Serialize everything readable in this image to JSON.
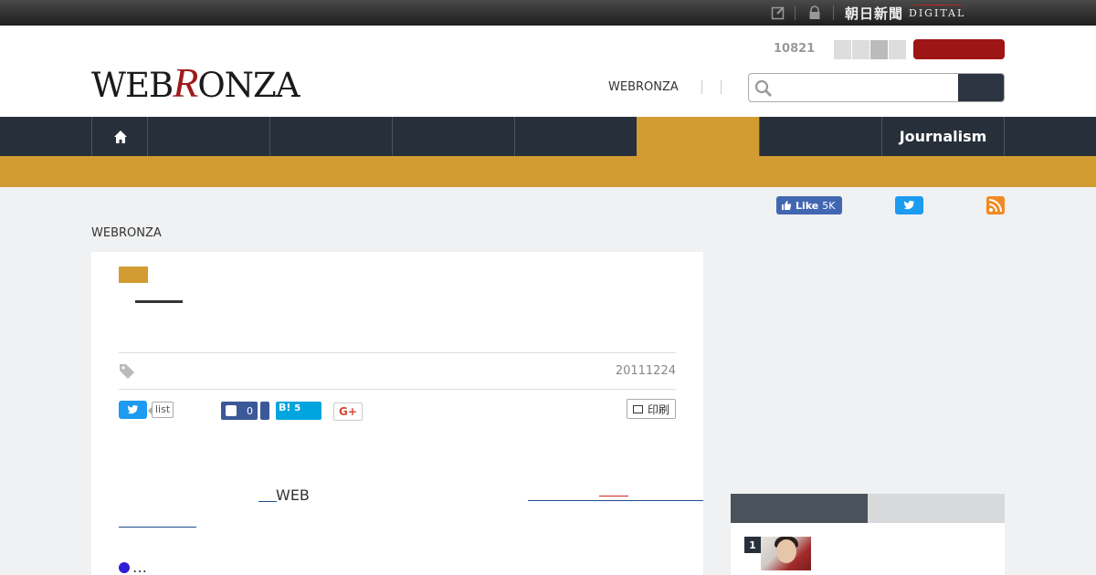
{
  "topbar": {
    "brand_jp": "朝日新聞",
    "brand_en": "DIGITAL",
    "icons": [
      "edit-icon",
      "lock-icon"
    ]
  },
  "header": {
    "logo_parts": [
      "WEB",
      "R",
      "ONZA"
    ],
    "counter": "10821",
    "link_webronza": "WEBRONZA",
    "search_placeholder": ""
  },
  "nav": {
    "home_icon": "home-icon",
    "active_index": 5,
    "last_label": "Journalism"
  },
  "social_top": {
    "fb_like_label": "Like",
    "fb_like_count": "5K",
    "icons": [
      "twitter-icon",
      "rss-icon"
    ]
  },
  "breadcrumb": "WEBRONZA",
  "article": {
    "date": "20111224",
    "tw_count_label": "list",
    "fb_share_count": "0",
    "hatena_label": "B!",
    "hatena_count": "5",
    "gplus_label": "G+",
    "print_label": "印刷",
    "body_fragment": "WEB",
    "bullet_text": "…"
  },
  "ranking": {
    "first_rank": "1"
  },
  "colors": {
    "accent": "#d39c33",
    "nav_bg": "#27303a",
    "login_red": "#9e1515",
    "twitter": "#1d9bf0",
    "facebook": "#3b5998",
    "hatena": "#00a4de"
  }
}
